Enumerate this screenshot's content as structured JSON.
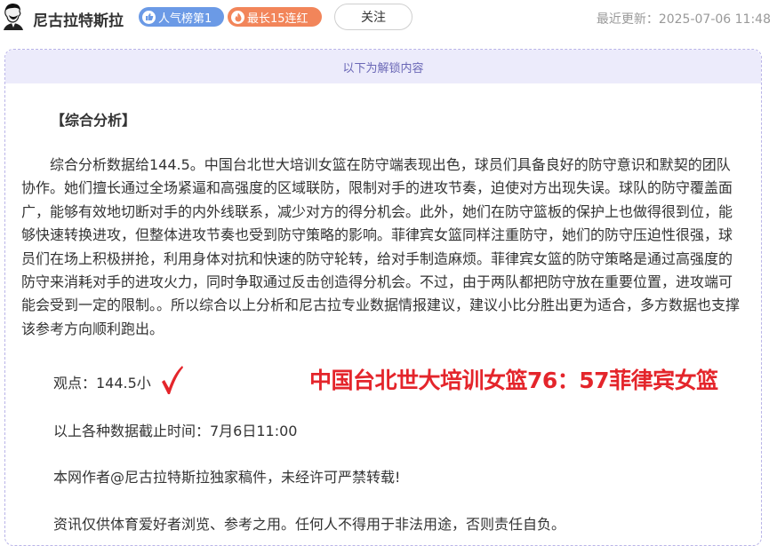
{
  "header": {
    "author_name": "尼古拉特斯拉",
    "badge_rank": "人气榜第1",
    "badge_streak": "最长15连红",
    "follow_label": "关注",
    "update_time": "最近更新：2025-07-06 11:48"
  },
  "card": {
    "unlock_label": "以下为解锁内容",
    "section_title": "【综合分析】",
    "analysis": "综合分析数据给144.5。中国台北世大培训女篮在防守端表现出色，球员们具备良好的防守意识和默契的团队协作。她们擅长通过全场紧逼和高强度的区域联防，限制对手的进攻节奏，迫使对方出现失误。球队的防守覆盖面广，能够有效地切断对手的内外线联系，减少对方的得分机会。此外，她们在防守篮板的保护上也做得很到位，能够快速转换进攻，但整体进攻节奏也受到防守策略的影响。菲律宾女篮同样注重防守，她们的防守压迫性很强，球员们在场上积极拼抢，利用身体对抗和快速的防守轮转，给对手制造麻烦。菲律宾女篮的防守策略是通过高强度的防守来消耗对手的进攻火力，同时争取通过反击创造得分机会。不过，由于两队都把防守放在重要位置，进攻端可能会受到一定的限制。。所以综合以上分析和尼古拉专业数据情报建议，建议小比分胜出更为适合，多方数据也支撑该参考方向顺利跑出。",
    "viewpoint": "观点：144.5小",
    "result": "中国台北世大培训女篮76：57菲律宾女篮",
    "cutoff": "以上各种数据截止时间：7月6日11:00",
    "copyright": "本网作者@尼古拉特斯拉独家稿件，未经许可严禁转载!",
    "disclaimer": "资讯仅供体育爱好者浏览、参考之用。任何人不得用于非法用途，否则责任自负。"
  },
  "colors": {
    "rank_badge": "#6b9ae6",
    "streak_badge": "#f2855a",
    "result_red": "#e4252b",
    "unlock_bg": "#ecebfb"
  },
  "icons": {
    "avatar": "tesla-portrait-avatar",
    "rank": "thumbs-up-icon",
    "streak": "flame-icon",
    "check": "red-check-icon"
  }
}
